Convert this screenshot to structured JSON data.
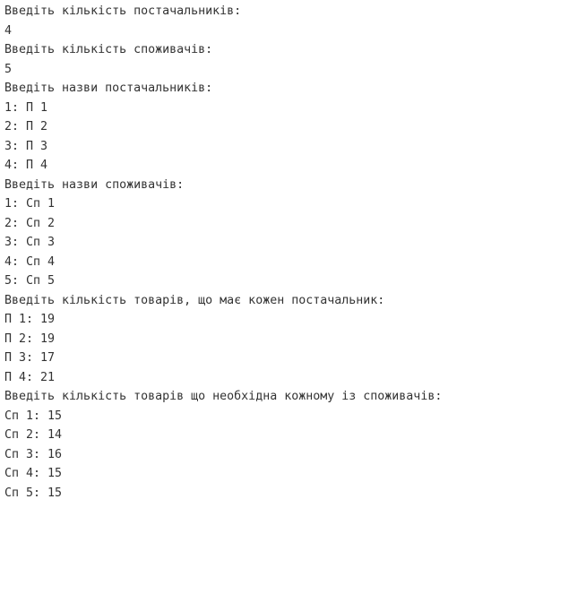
{
  "console": {
    "lines": [
      "Введіть кількість постачальників:",
      "4",
      "Введіть кількість споживачів:",
      "5",
      "Введіть назви постачальників:",
      "1: П 1",
      "2: П 2",
      "3: П 3",
      "4: П 4",
      "Введіть назви споживачів:",
      "1: Сп 1",
      "2: Сп 2",
      "3: Сп 3",
      "4: Сп 4",
      "5: Сп 5",
      "Введіть кількість товарів, що має кожен постачальник:",
      "П 1: 19",
      "П 2: 19",
      "П 3: 17",
      "П 4: 21",
      "Введіть кількість товарів що необхідна кожному із споживачів:",
      "Сп 1: 15",
      "Сп 2: 14",
      "Сп 3: 16",
      "Сп 4: 15",
      "Сп 5: 15"
    ]
  }
}
